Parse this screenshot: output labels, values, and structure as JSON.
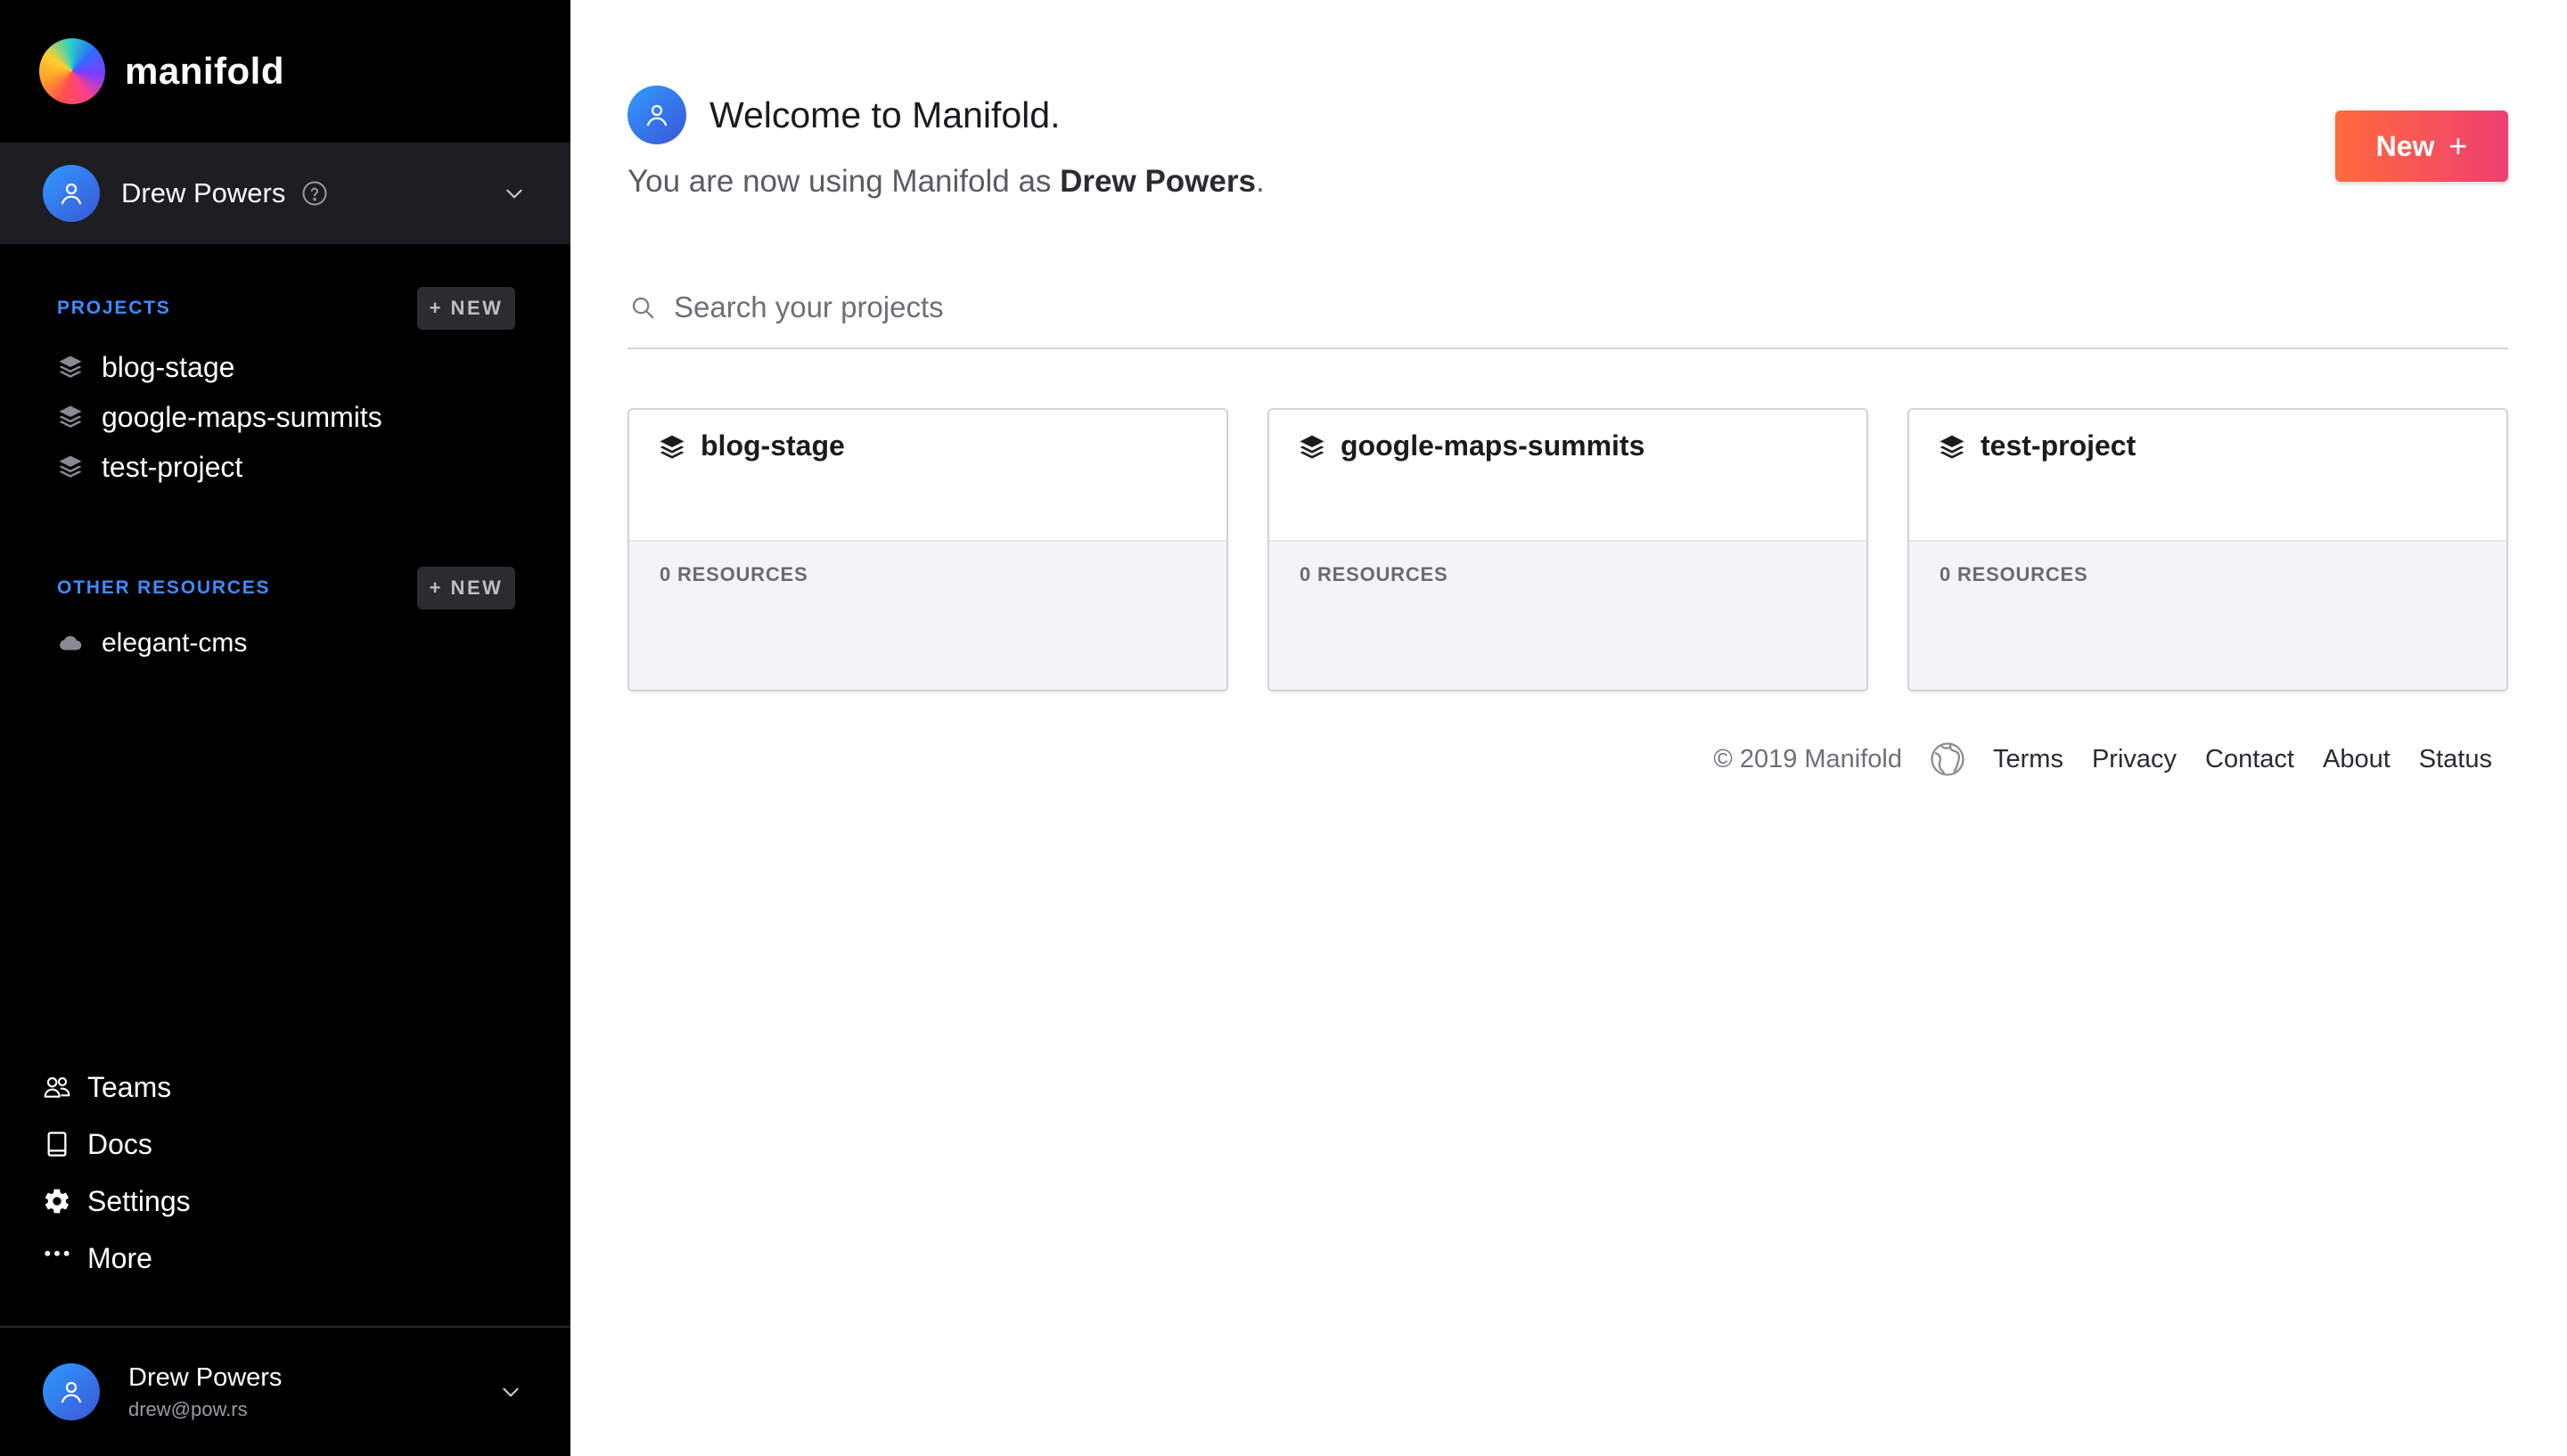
{
  "brand": {
    "name": "manifold"
  },
  "user_switcher": {
    "name": "Drew Powers"
  },
  "projects": {
    "title": "PROJECTS",
    "new_label": "+ NEW",
    "items": [
      {
        "label": "blog-stage"
      },
      {
        "label": "google-maps-summits"
      },
      {
        "label": "test-project"
      }
    ]
  },
  "other_resources": {
    "title": "OTHER RESOURCES",
    "new_label": "+ NEW",
    "items": [
      {
        "label": "elegant-cms"
      }
    ]
  },
  "bottom_nav": {
    "teams": "Teams",
    "docs": "Docs",
    "settings": "Settings",
    "more": "More"
  },
  "account": {
    "name": "Drew Powers",
    "email": "drew@pow.rs"
  },
  "main": {
    "welcome_title": "Welcome to Manifold.",
    "subtitle_prefix": "You are now using Manifold as ",
    "subtitle_name": "Drew Powers",
    "subtitle_suffix": ".",
    "new_button": "New",
    "search_placeholder": "Search your projects",
    "cards": [
      {
        "name": "blog-stage",
        "resources": "0 RESOURCES"
      },
      {
        "name": "google-maps-summits",
        "resources": "0 RESOURCES"
      },
      {
        "name": "test-project",
        "resources": "0 RESOURCES"
      }
    ]
  },
  "footer": {
    "copyright": "© 2019 Manifold",
    "links": [
      "Terms",
      "Privacy",
      "Contact",
      "About",
      "Status"
    ]
  },
  "colors": {
    "sidebar_bg": "#000000",
    "user_switcher_bg": "#1e1e22",
    "section_title": "#3d8bff",
    "new_button_gradient_start": "#ff6a3d",
    "new_button_gradient_end": "#ee3f73"
  },
  "icons": {
    "brand": "manifold-logo",
    "avatar": "user-icon",
    "help": "help-circle-icon",
    "chevron": "chevron-down-icon",
    "project": "layers-icon",
    "resource": "cloud-icon",
    "teams": "users-icon",
    "docs": "book-icon",
    "settings": "gear-icon",
    "more": "more-dots-icon",
    "search": "search-icon",
    "footer_logo": "globe-icon"
  }
}
